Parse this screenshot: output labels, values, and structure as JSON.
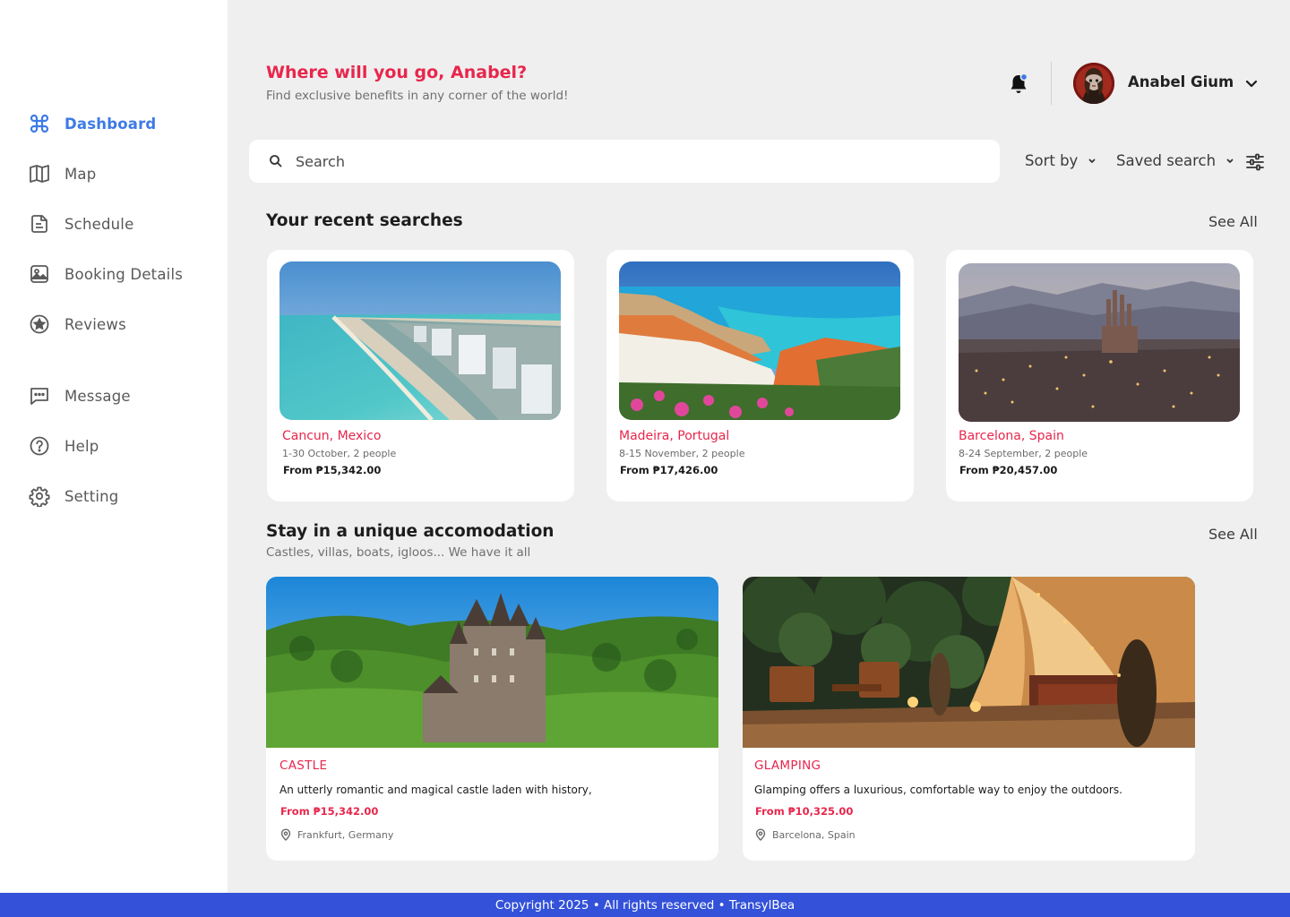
{
  "sidebar": {
    "items": [
      {
        "label": "Dashboard",
        "icon": "command-icon",
        "active": true
      },
      {
        "label": "Map",
        "icon": "map-icon"
      },
      {
        "label": "Schedule",
        "icon": "document-icon"
      },
      {
        "label": "Booking Details",
        "icon": "image-icon"
      },
      {
        "label": "Reviews",
        "icon": "star-icon"
      },
      {
        "label": "Message",
        "icon": "message-icon"
      },
      {
        "label": "Help",
        "icon": "help-icon"
      },
      {
        "label": "Setting",
        "icon": "gear-icon"
      }
    ]
  },
  "header": {
    "greeting": "Where will you go, Anabel?",
    "subtitle": "Find exclusive benefits in any corner of the world!",
    "user_name": "Anabel Gium"
  },
  "search": {
    "placeholder": "Search",
    "sort_label": "Sort by",
    "saved_label": "Saved search"
  },
  "recent": {
    "title": "Your recent searches",
    "see_all": "See All",
    "cards": [
      {
        "place": "Cancun, Mexico",
        "dates": "1-30 October, 2 people",
        "price": "From ₱15,342.00"
      },
      {
        "place": "Madeira, Portugal",
        "dates": "8-15 November, 2 people",
        "price": "From ₱17,426.00"
      },
      {
        "place": "Barcelona, Spain",
        "dates": "8-24 September, 2 people",
        "price": "From ₱20,457.00"
      }
    ]
  },
  "unique": {
    "title": "Stay in a unique accomodation",
    "subtitle": "Castles, villas, boats, igloos... We have it all",
    "see_all": "See All",
    "cards": [
      {
        "category": "CASTLE",
        "description": "An utterly romantic and magical castle laden with history,",
        "price": "From ₱15,342.00",
        "location": "Frankfurt, Germany"
      },
      {
        "category": "GLAMPING",
        "description": "Glamping offers a luxurious, comfortable way to enjoy the outdoors.",
        "price": "From ₱10,325.00",
        "location": "Barcelona, Spain"
      }
    ]
  },
  "footer": {
    "text": "Copyright 2025 • All rights reserved • TransylBea"
  },
  "colors": {
    "accent": "#e8264c",
    "active_nav": "#3d7ae5",
    "footer_bg": "#3352d9",
    "page_bg": "#efefef"
  }
}
